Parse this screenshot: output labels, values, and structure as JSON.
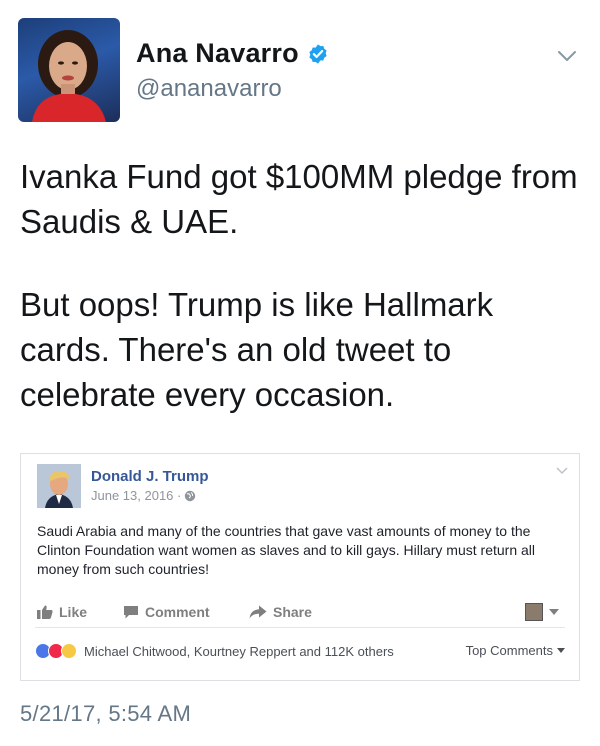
{
  "tweet": {
    "author": {
      "display_name": "Ana Navarro",
      "handle": "@ananavarro",
      "verified": true
    },
    "paragraphs": [
      "Ivanka Fund got $100MM pledge from Saudis & UAE.",
      "But oops! Trump is like Hallmark cards. There's an old tweet to celebrate every occasion."
    ],
    "timestamp": "5/21/17, 5:54 AM"
  },
  "embedded_post": {
    "author": "Donald J. Trump",
    "date": "June 13, 2016 ·",
    "text": "Saudi Arabia and many of the countries that gave vast amounts of money to the Clinton Foundation want women as slaves and to kill gays. Hillary must return all money from such countries!",
    "actions": {
      "like": "Like",
      "comment": "Comment",
      "share": "Share"
    },
    "reactions_text": "Michael Chitwood, Kourtney Reppert and 112K others",
    "top_comments": "Top Comments"
  },
  "colors": {
    "twitter_blue": "#1da1f2",
    "facebook_link": "#365899",
    "muted": "#657786"
  },
  "icons": [
    "verified-badge-icon",
    "chevron-down-icon",
    "globe-icon",
    "like-thumb-icon",
    "comment-icon",
    "share-arrow-icon",
    "like-reaction-icon",
    "love-reaction-icon",
    "haha-reaction-icon"
  ]
}
